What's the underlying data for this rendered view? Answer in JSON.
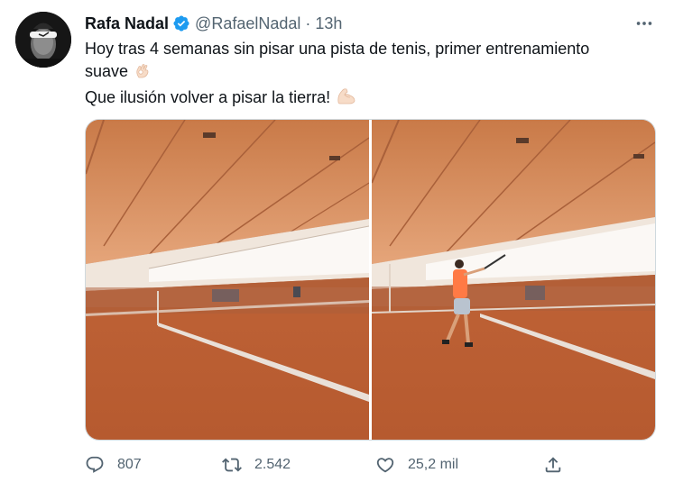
{
  "tweet": {
    "author_name": "Rafa Nadal",
    "handle": "@RafaelNadal",
    "separator": "·",
    "time": "13h",
    "text_line1": "Hoy tras 4 semanas sin pisar una pista de tenis, primer entrenamiento",
    "text_line2": "suave",
    "text_line3": "Que ilusión volver a pisar la tierra!",
    "emoji_1": "ok-hand-emoji",
    "emoji_2": "flexed-biceps-emoji"
  },
  "actions": {
    "replies": "807",
    "retweets": "2.542",
    "likes": "25,2 mil"
  },
  "icons": {
    "verified": "verified-badge-icon",
    "more": "more-options-icon",
    "reply": "reply-icon",
    "retweet": "retweet-icon",
    "like": "heart-icon",
    "share": "share-icon"
  },
  "colors": {
    "verified": "#1d9bf0",
    "text": "#0f1419",
    "secondary": "#536471",
    "clay": "#c4663a",
    "roof": "#d78a5a"
  }
}
